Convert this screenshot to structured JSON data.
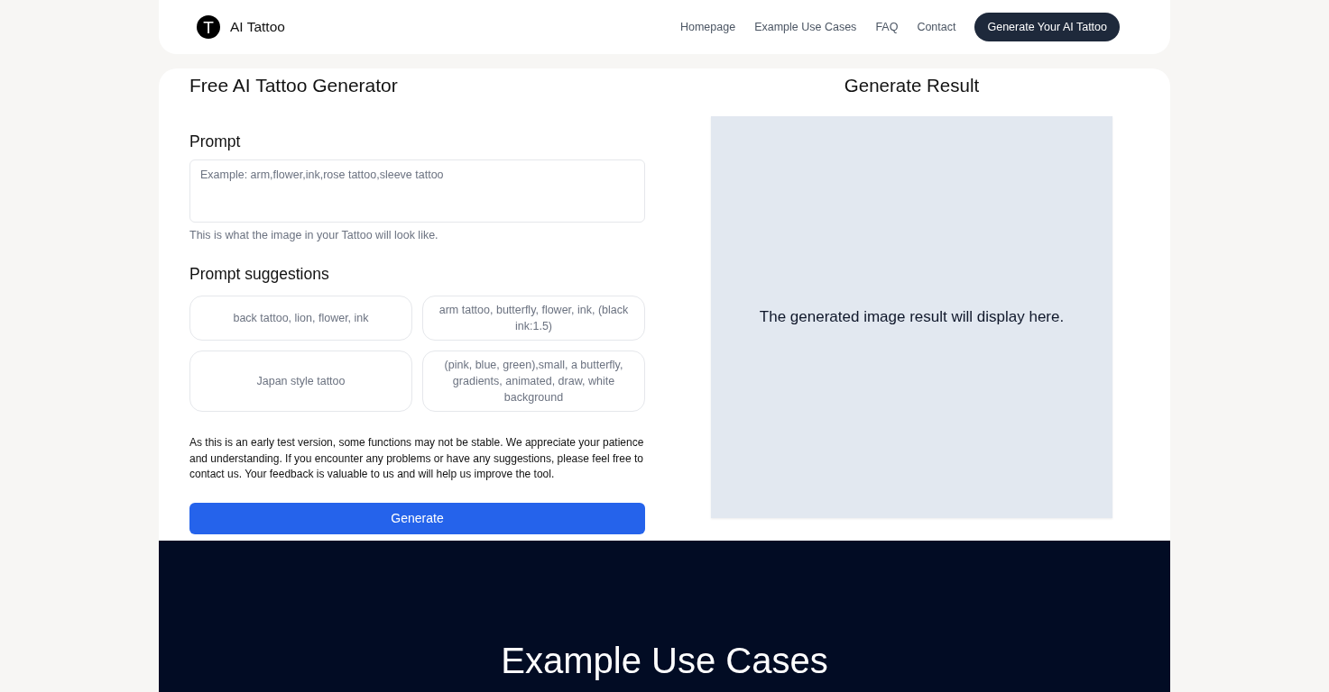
{
  "header": {
    "logo": {
      "letter": "T"
    },
    "brand": "AI Tattoo",
    "nav_links": [
      "Homepage",
      "Example Use Cases",
      "FAQ",
      "Contact"
    ],
    "cta_button": "Generate Your AI Tattoo"
  },
  "generator": {
    "title": "Free AI Tattoo Generator",
    "prompt": {
      "label": "Prompt",
      "placeholder": "Example: arm,flower,ink,rose tattoo,sleeve tattoo",
      "hint": "This is what the image in your Tattoo will look like."
    },
    "suggestions": {
      "title": "Prompt suggestions",
      "items": [
        "back tattoo, lion, flower, ink",
        "arm tattoo, butterfly, flower, ink, (black ink:1.5)",
        "Japan style tattoo",
        "(pink, blue, green),small, a butterfly, gradients, animated, draw, white background"
      ]
    },
    "notice": "As this is an early test version, some functions may not be stable. We appreciate your patience and understanding. If you encounter any problems or have any suggestions, please feel free to contact us. Your feedback is valuable to us and will help us improve the tool.",
    "generate_button": "Generate"
  },
  "result": {
    "title": "Generate Result",
    "placeholder_text": "The generated image result will display here."
  },
  "use_cases": {
    "title": "Example Use Cases"
  }
}
